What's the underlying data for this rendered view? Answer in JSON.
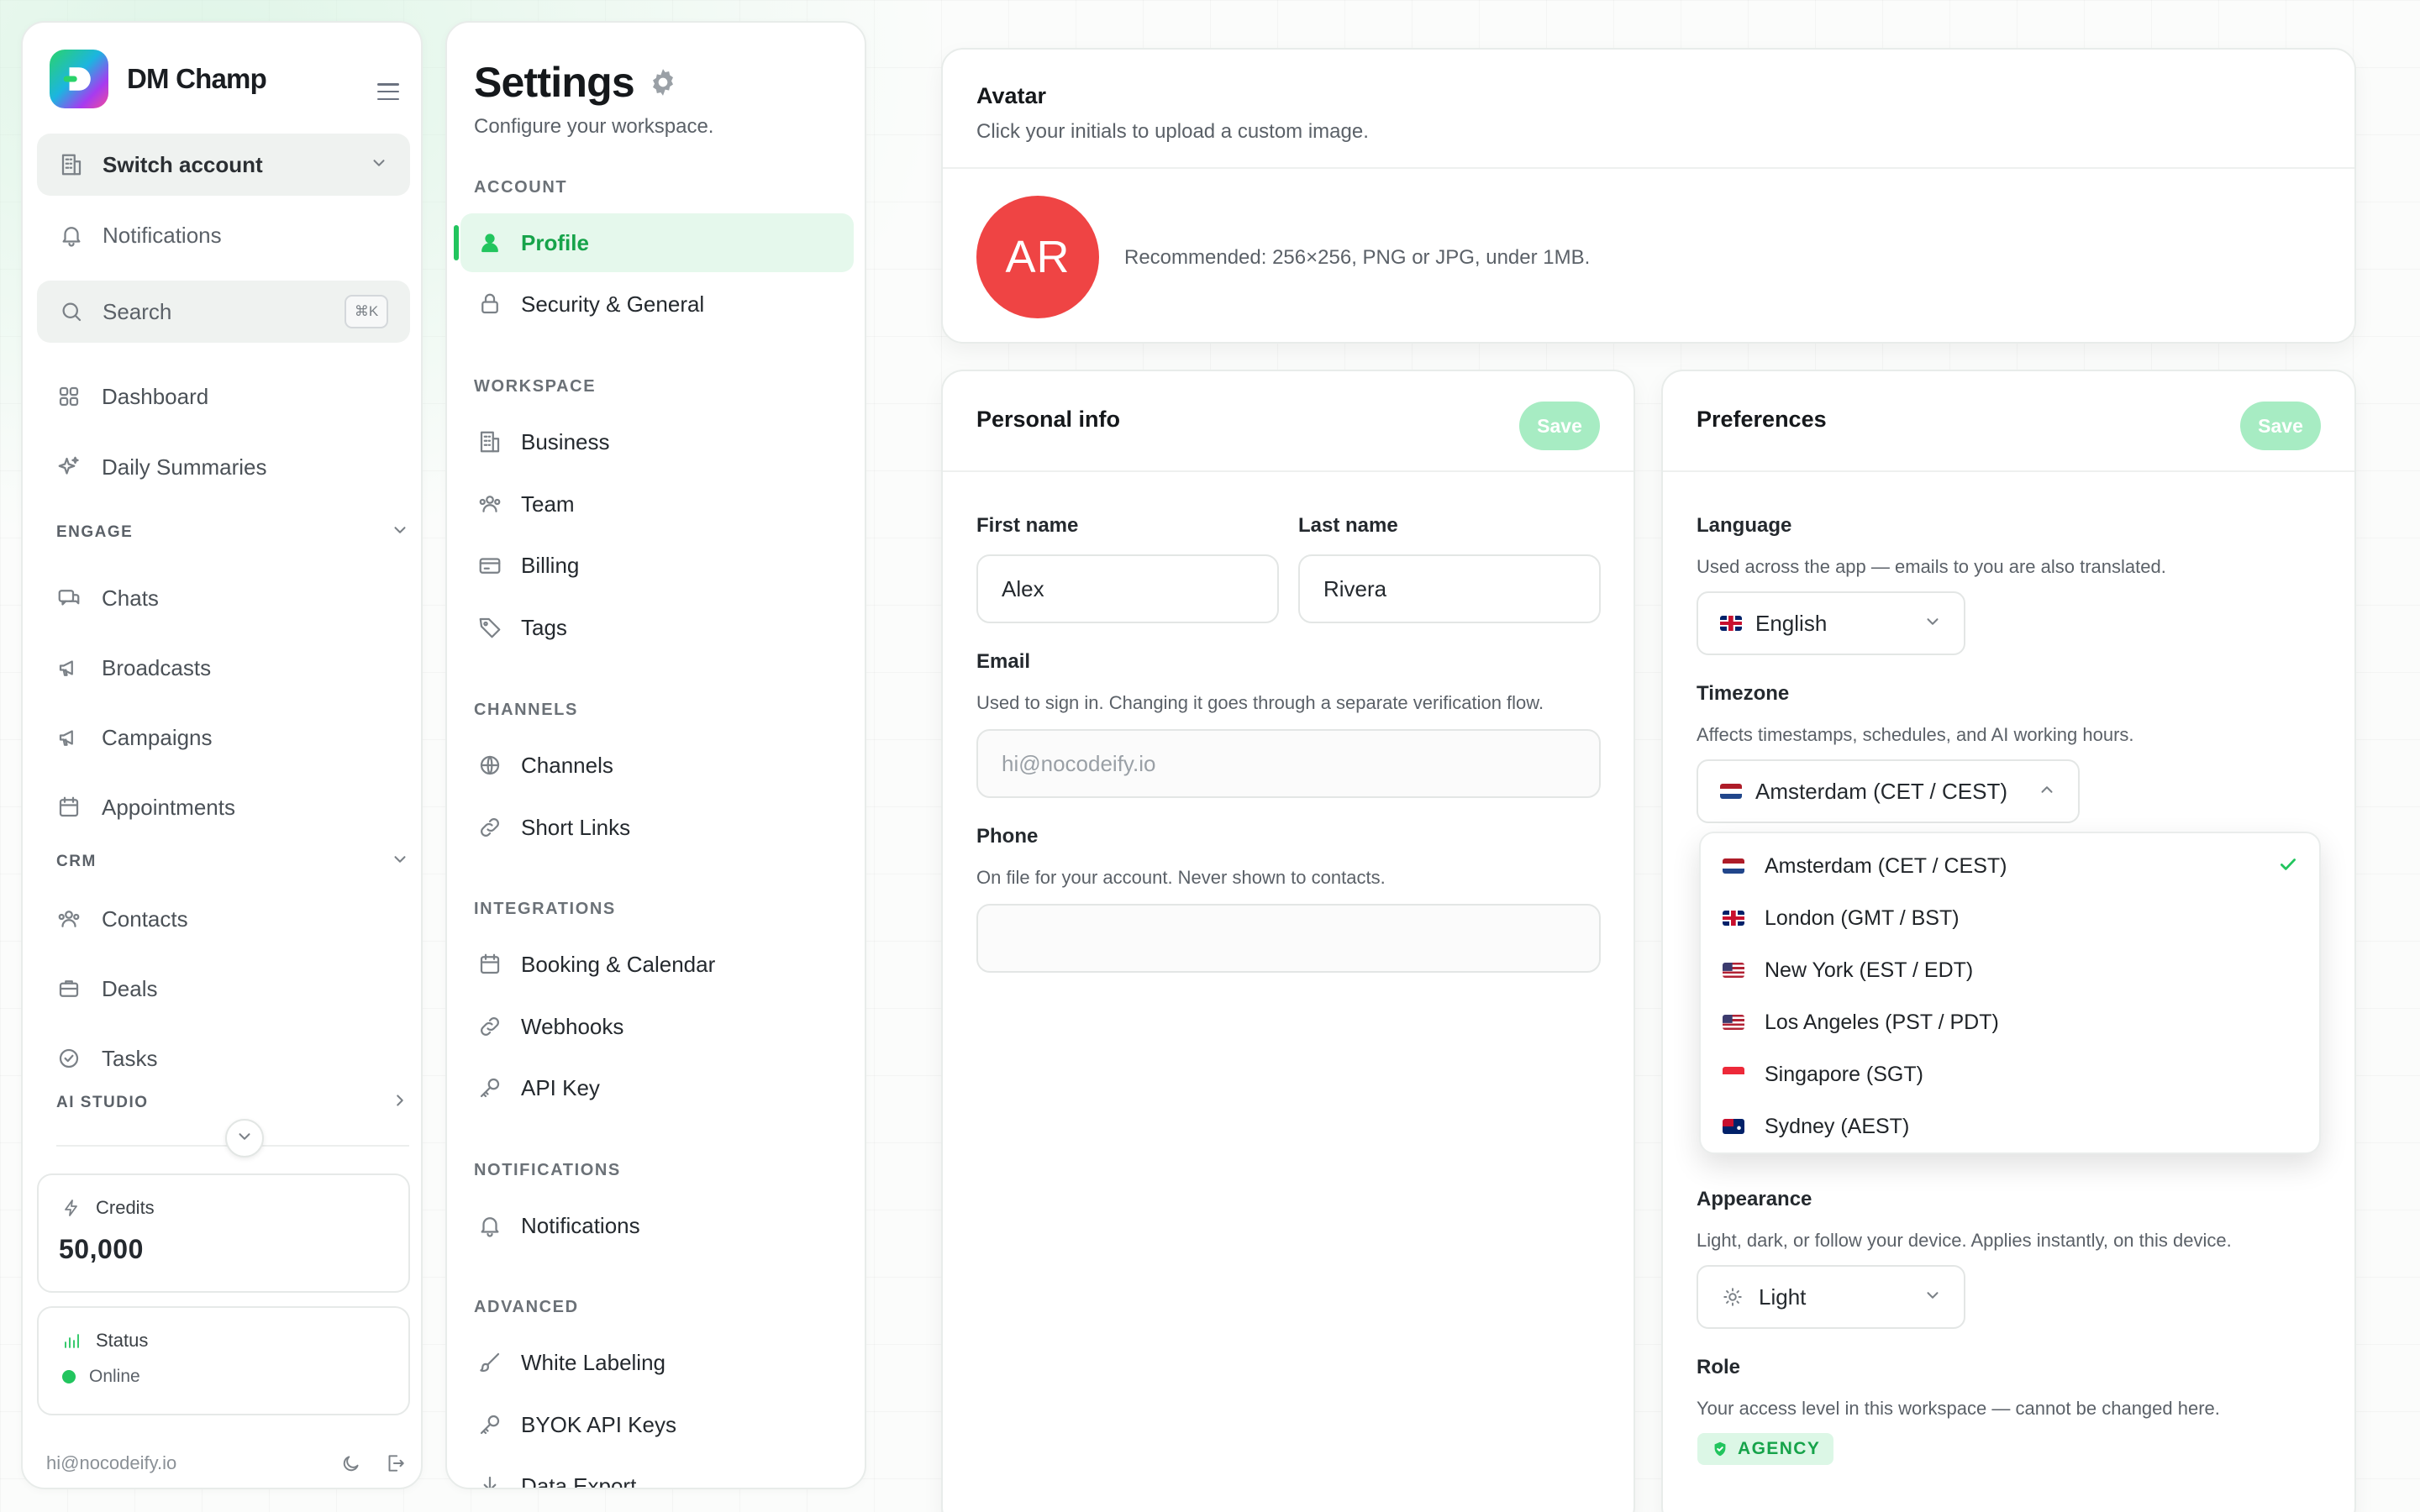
{
  "brand": {
    "name": "DM Champ"
  },
  "sidebar": {
    "switch_account": "Switch account",
    "notifications": "Notifications",
    "search_placeholder": "Search",
    "search_shortcut": "⌘K",
    "items": {
      "dashboard": "Dashboard",
      "daily_summaries": "Daily Summaries",
      "chats": "Chats",
      "broadcasts": "Broadcasts",
      "campaigns": "Campaigns",
      "appointments": "Appointments",
      "contacts": "Contacts",
      "deals": "Deals",
      "tasks": "Tasks"
    },
    "sections": {
      "engage": "ENGAGE",
      "crm": "CRM",
      "ai_studio": "AI STUDIO"
    },
    "credits_label": "Credits",
    "credits_value": "50,000",
    "status_label": "Status",
    "status_value": "Online",
    "status_color": "#22c55e",
    "user_email": "hi@nocodeify.io"
  },
  "settings_nav": {
    "title": "Settings",
    "subtitle": "Configure your workspace.",
    "sections": {
      "account": "ACCOUNT",
      "workspace": "WORKSPACE",
      "channels": "CHANNELS",
      "integrations": "INTEGRATIONS",
      "notifications": "NOTIFICATIONS",
      "advanced": "ADVANCED"
    },
    "items": {
      "profile": "Profile",
      "security": "Security & General",
      "business": "Business",
      "team": "Team",
      "billing": "Billing",
      "tags": "Tags",
      "channels": "Channels",
      "short_links": "Short Links",
      "booking": "Booking & Calendar",
      "webhooks": "Webhooks",
      "api_key": "API Key",
      "notifications": "Notifications",
      "white_labeling": "White Labeling",
      "byok": "BYOK API Keys",
      "data_export": "Data Export"
    },
    "active": "Profile"
  },
  "avatar_card": {
    "title": "Avatar",
    "subtitle": "Click your initials to upload a custom image.",
    "initials": "AR",
    "note": "Recommended: 256×256, PNG or JPG, under 1MB.",
    "avatar_color": "#ef4444"
  },
  "personal_info": {
    "title": "Personal info",
    "save_label": "Save",
    "first_name_label": "First name",
    "first_name_value": "Alex",
    "last_name_label": "Last name",
    "last_name_value": "Rivera",
    "email_label": "Email",
    "email_help": "Used to sign in. Changing it goes through a separate verification flow.",
    "email_value": "hi@nocodeify.io",
    "phone_label": "Phone",
    "phone_help": "On file for your account. Never shown to contacts.",
    "phone_value": ""
  },
  "preferences": {
    "title": "Preferences",
    "save_label": "Save",
    "language_label": "Language",
    "language_help": "Used across the app — emails to you are also translated.",
    "language_value": "English",
    "timezone_label": "Timezone",
    "timezone_help": "Affects timestamps, schedules, and AI working hours.",
    "timezone_value": "Amsterdam (CET / CEST)",
    "timezone_options": [
      {
        "label": "Amsterdam (CET / CEST)",
        "flag": "nl",
        "selected": true
      },
      {
        "label": "London (GMT / BST)",
        "flag": "gb",
        "selected": false
      },
      {
        "label": "New York (EST / EDT)",
        "flag": "us",
        "selected": false
      },
      {
        "label": "Los Angeles (PST / PDT)",
        "flag": "us",
        "selected": false
      },
      {
        "label": "Singapore (SGT)",
        "flag": "sg",
        "selected": false
      },
      {
        "label": "Sydney (AEST)",
        "flag": "au",
        "selected": false
      }
    ],
    "appearance_label": "Appearance",
    "appearance_help": "Light, dark, or follow your device. Applies instantly, on this device.",
    "appearance_value": "Light",
    "role_label": "Role",
    "role_help": "Your access level in this workspace — cannot be changed here.",
    "role_value": "AGENCY",
    "accent_color": "#22c55e"
  }
}
